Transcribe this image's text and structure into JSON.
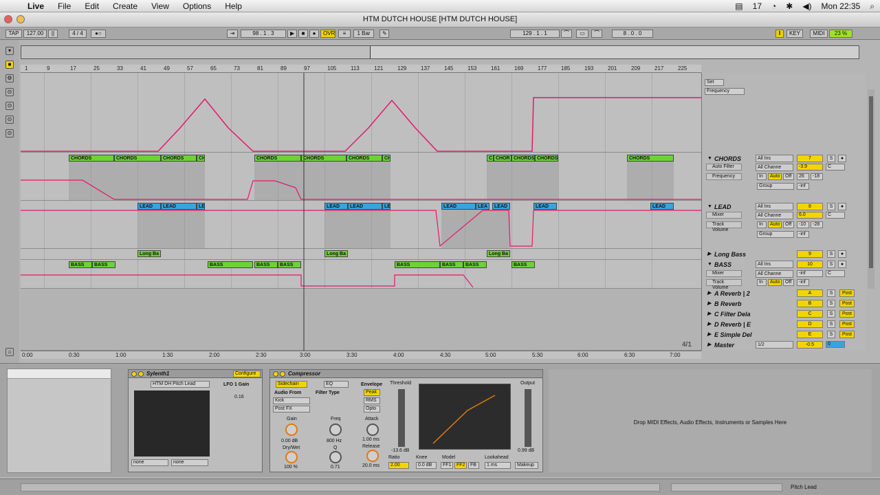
{
  "menubar": {
    "app": "Live",
    "menus": [
      "File",
      "Edit",
      "Create",
      "View",
      "Options",
      "Help"
    ],
    "day": "17",
    "clock": "Mon 22:35"
  },
  "window": {
    "title": "HTM DUTCH HOUSE  [HTM DUTCH HOUSE]"
  },
  "transport": {
    "tap": "TAP",
    "tempo": "127.00",
    "signature": "4 / 4",
    "position": "98 . 1 . 3",
    "ovr": "OVR",
    "quantize": "1 Bar",
    "loop_start": "129 . 1 . 1",
    "loop_length": "8 . 0 . 0",
    "key": "KEY",
    "midi": "MIDI",
    "cpu": "23 %"
  },
  "ruler": {
    "bars": [
      "1",
      "9",
      "17",
      "25",
      "33",
      "41",
      "49",
      "57",
      "65",
      "73",
      "81",
      "89",
      "97",
      "105",
      "113",
      "121",
      "129",
      "137",
      "145",
      "153",
      "161",
      "169",
      "177",
      "185",
      "193",
      "201",
      "209",
      "217",
      "225"
    ],
    "times": [
      "0:00",
      "0:30",
      "1:00",
      "1:30",
      "2:00",
      "2:30",
      "3:00",
      "3:30",
      "4:00",
      "4:30",
      "5:00",
      "5:30",
      "6:00",
      "6:30",
      "7:00"
    ],
    "signature_marker": "4/1",
    "set_label": "Set"
  },
  "clips": {
    "chords": "CHORDS",
    "chords_short": "CH",
    "chords_c": "C",
    "chords_chor": "CHOR",
    "lead": "LEAD",
    "lead_short": "LE",
    "lead_l": "LEA",
    "long_bass": "Long Ba",
    "bass": "BASS"
  },
  "tracks": [
    {
      "name": "CHORDS",
      "input": "All Ins",
      "channel": "All Channe",
      "auto": "Auto Filter",
      "param": "Frequency",
      "num": "7",
      "vol": "-3.9",
      "pan": "C",
      "in": "In",
      "auto_btn": "Auto",
      "off": "Off",
      "send1": "26",
      "send2": "-18",
      "inf": "-inf",
      "group": "Group"
    },
    {
      "name": "LEAD",
      "input": "All Ins",
      "channel": "All Channe",
      "auto": "Mixer",
      "param": "Track Volume",
      "num": "8",
      "vol": "6.0",
      "pan": "C",
      "in": "In",
      "auto_btn": "Auto",
      "off": "Off",
      "send1": "-10",
      "send2": "-28",
      "inf": "-inf",
      "group": "Group"
    },
    {
      "name": "Long Bass",
      "num": "9"
    },
    {
      "name": "BASS",
      "input": "All Ins",
      "channel": "All Channe",
      "auto": "Mixer",
      "param": "Track Volume",
      "num": "10",
      "vol": "-inf",
      "pan": "C",
      "in": "In",
      "auto_btn": "Auto",
      "off": "Off",
      "inf": "-inf"
    },
    {
      "name": "A Reverb | 2",
      "num": "A",
      "post": "Post"
    },
    {
      "name": "B Reverb",
      "num": "B",
      "post": "Post"
    },
    {
      "name": "C Filter Dela",
      "num": "C",
      "post": "Post"
    },
    {
      "name": "D Reverb | E",
      "num": "D",
      "post": "Post"
    },
    {
      "name": "E Simple Del",
      "num": "E",
      "post": "Post"
    },
    {
      "name": "Master",
      "num": "0",
      "vol": "-0.5",
      "io": "1/2"
    }
  ],
  "top_param": "Frequency",
  "sylenth": {
    "title": "Sylenth1",
    "configure": "Configure",
    "preset": "HTM DH Pitch Lead",
    "lfo_label": "LFO 1 Gain",
    "lfo_value": "0.16",
    "none1": "none",
    "none2": "none"
  },
  "compressor": {
    "title": "Compressor",
    "sidechain": "Sidechain",
    "eq": "EQ",
    "audio_from": "Audio From",
    "source": "Kick",
    "post_fx": "Post FX",
    "filter_type": "Filter Type",
    "gain_label": "Gain",
    "gain": "0.00 dB",
    "freq_label": "Freq",
    "freq": "800 Hz",
    "drywet_label": "Dry/Wet",
    "drywet": "100 %",
    "q_label": "Q",
    "q": "0.71",
    "envelope": "Envelope",
    "peak": "Peak",
    "rms": "RMS",
    "opto": "Opto",
    "attack_label": "Attack",
    "attack": "1.00 ms",
    "release_label": "Release",
    "release": "20.0 ms",
    "threshold_label": "Threshold",
    "threshold": "-13.6 dB",
    "output_label": "Output",
    "output": "0.99 dB",
    "ratio_label": "Ratio",
    "ratio": "2.00",
    "knee_label": "Knee",
    "knee": "0.0 dB",
    "model_label": "Model",
    "ff1": "FF1",
    "ff2": "FF2",
    "fb": "FB",
    "lookahead_label": "Lookahead",
    "lookahead": "1 ms",
    "makeup": "Makeup"
  },
  "drop_text": "Drop MIDI Effects, Audio Effects, Instruments or Samples Here",
  "status": {
    "track": "Pitch Lead"
  },
  "colors": {
    "clip_green": "#6cd23a",
    "clip_blue": "#39a3e0",
    "automation": "#e8156a",
    "accent_yellow": "#f2d500"
  }
}
